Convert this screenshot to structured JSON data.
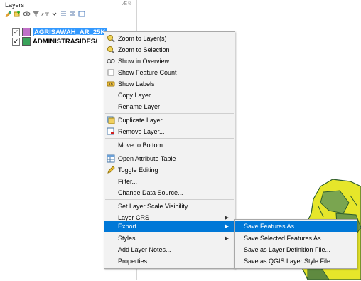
{
  "panel": {
    "title": "Layers",
    "controls": "Æ®"
  },
  "toolbar": {
    "icons": [
      "style-manager-icon",
      "add-group-icon",
      "manage-visibility-icon",
      "filter-legend-icon",
      "filter-expression-icon",
      "expand-all-icon",
      "collapse-all-icon",
      "remove-layer-icon"
    ]
  },
  "layers": [
    {
      "name": "AGRISAWAH_AR_25K",
      "checked": "✓",
      "color": "#c070c8",
      "selected": true
    },
    {
      "name": "ADMINISTRASIDES/",
      "checked": "✓",
      "color": "#3aa35a",
      "selected": false
    }
  ],
  "menu": {
    "items": [
      {
        "label": "Zoom to Layer(s)",
        "icon": "zoom-layer-icon"
      },
      {
        "label": "Zoom to Selection",
        "icon": "zoom-selection-icon"
      },
      {
        "label": "Show in Overview",
        "icon": "overview-icon"
      },
      {
        "label": "Show Feature Count",
        "icon": "checkbox-icon"
      },
      {
        "label": "Show Labels",
        "icon": "labels-icon"
      },
      {
        "label": "Copy Layer",
        "icon": ""
      },
      {
        "label": "Rename Layer",
        "icon": ""
      },
      {
        "label": "Duplicate Layer",
        "icon": "duplicate-layer-icon"
      },
      {
        "label": "Remove Layer...",
        "icon": "remove-layer-icon"
      },
      {
        "label": "Move to Bottom",
        "icon": ""
      },
      {
        "label": "Open Attribute Table",
        "icon": "attribute-table-icon"
      },
      {
        "label": "Toggle Editing",
        "icon": "pencil-icon"
      },
      {
        "label": "Filter...",
        "icon": ""
      },
      {
        "label": "Change Data Source...",
        "icon": ""
      },
      {
        "label": "Set Layer Scale Visibility...",
        "icon": ""
      },
      {
        "label": "Layer CRS",
        "icon": "",
        "submenu": "▶"
      },
      {
        "label": "Export",
        "icon": "",
        "submenu": "▶",
        "active": true
      },
      {
        "label": "Styles",
        "icon": "",
        "submenu": "▶"
      },
      {
        "label": "Add Layer Notes...",
        "icon": ""
      },
      {
        "label": "Properties...",
        "icon": ""
      }
    ]
  },
  "export_submenu": {
    "items": [
      {
        "label": "Save Features As...",
        "active": true
      },
      {
        "label": "Save Selected Features As..."
      },
      {
        "label": "Save as Layer Definition File..."
      },
      {
        "label": "Save as QGIS Layer Style File..."
      }
    ]
  },
  "colors": {
    "accent": "#0078d7",
    "selection": "#3399ff",
    "map_fill": "#e6e62a",
    "map_stroke": "#2f5e2f"
  }
}
